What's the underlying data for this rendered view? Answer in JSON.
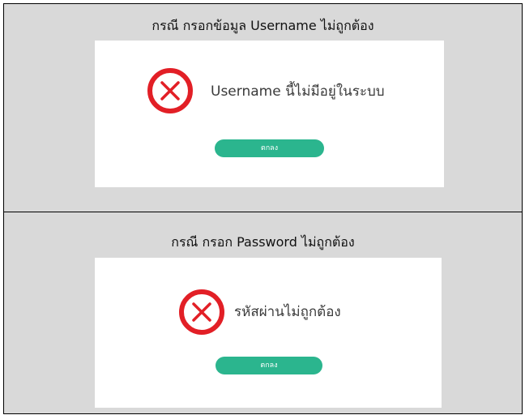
{
  "cases": [
    {
      "caption": "กรณี กรอกข้อมูล Username ไม่ถูกต้อง",
      "dialog": {
        "icon": "error-x-circle-icon",
        "message": "Username นี้ไม่มีอยู่ในระบบ",
        "button_label": "ตกลง"
      }
    },
    {
      "caption": "กรณี กรอก Password ไม่ถูกต้อง",
      "dialog": {
        "icon": "error-x-circle-icon",
        "message": "รหัสผ่านไม่ถูกต้อง",
        "button_label": "ตกลง"
      }
    }
  ],
  "colors": {
    "cell_background": "#d9d9d9",
    "error_red": "#e21f26",
    "button_green": "#2bb58e",
    "message_text": "#3a3a3a"
  }
}
